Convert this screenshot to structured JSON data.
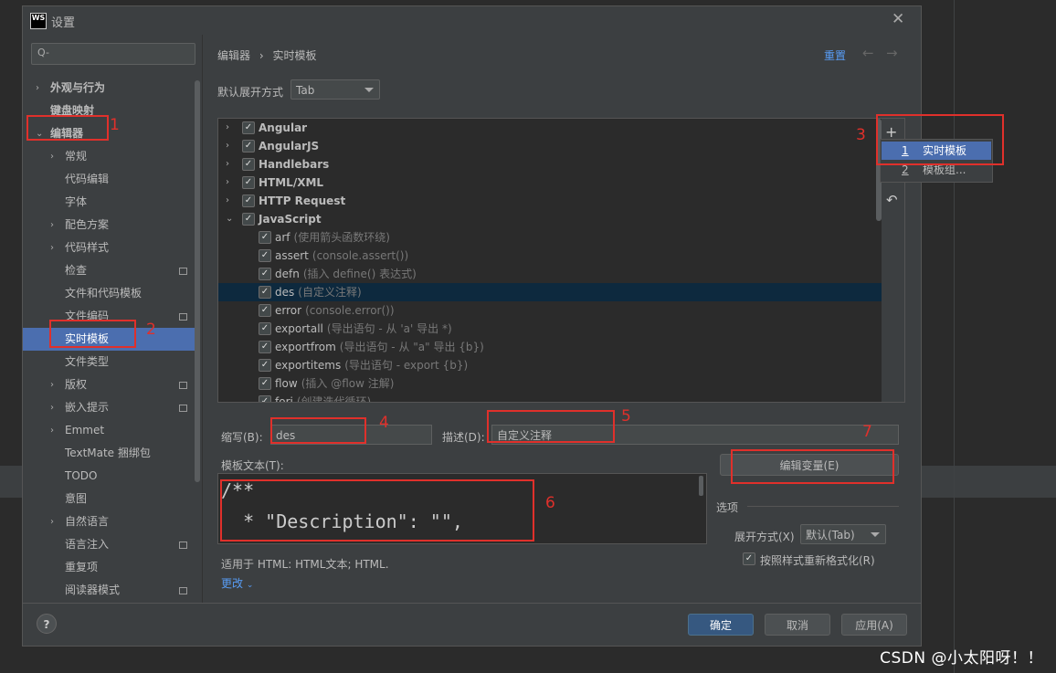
{
  "watermark": "CSDN @小太阳呀！！",
  "dialog": {
    "title": "设置",
    "app_icon_text": "WS",
    "close_glyph": "✕"
  },
  "sidebar": {
    "search_placeholder": "Q-",
    "items": [
      {
        "label": "外观与行为",
        "chevron": "›",
        "bold": true
      },
      {
        "label": "键盘映射",
        "chevron": "",
        "bold": true
      },
      {
        "label": "编辑器",
        "chevron": "⌄",
        "bold": true
      },
      {
        "label": "常规",
        "chevron": "›"
      },
      {
        "label": "代码编辑",
        "chevron": ""
      },
      {
        "label": "字体",
        "chevron": ""
      },
      {
        "label": "配色方案",
        "chevron": "›"
      },
      {
        "label": "代码样式",
        "chevron": "›"
      },
      {
        "label": "检查",
        "chevron": "",
        "mini": true
      },
      {
        "label": "文件和代码模板",
        "chevron": ""
      },
      {
        "label": "文件编码",
        "chevron": "",
        "mini": true
      },
      {
        "label": "实时模板",
        "chevron": "",
        "selected": true
      },
      {
        "label": "文件类型",
        "chevron": ""
      },
      {
        "label": "版权",
        "chevron": "›",
        "mini": true
      },
      {
        "label": "嵌入提示",
        "chevron": "›",
        "mini": true
      },
      {
        "label": "Emmet",
        "chevron": "›"
      },
      {
        "label": "TextMate 捆绑包",
        "chevron": ""
      },
      {
        "label": "TODO",
        "chevron": ""
      },
      {
        "label": "意图",
        "chevron": ""
      },
      {
        "label": "自然语言",
        "chevron": "›"
      },
      {
        "label": "语言注入",
        "chevron": "",
        "mini": true
      },
      {
        "label": "重复项",
        "chevron": ""
      },
      {
        "label": "阅读器模式",
        "chevron": "",
        "mini": true
      }
    ]
  },
  "header": {
    "breadcrumb_parent": "编辑器",
    "breadcrumb_sep": "›",
    "breadcrumb_current": "实时模板",
    "reset_label": "重置",
    "back_arrow": "←",
    "forward_arrow": "→"
  },
  "expand_with": {
    "label": "默认展开方式",
    "value": "Tab"
  },
  "template_list": [
    {
      "name": "Angular",
      "group": true,
      "expanded": false,
      "checked": true
    },
    {
      "name": "AngularJS",
      "group": true,
      "expanded": false,
      "checked": true
    },
    {
      "name": "Handlebars",
      "group": true,
      "expanded": false,
      "checked": true
    },
    {
      "name": "HTML/XML",
      "group": true,
      "expanded": false,
      "checked": true
    },
    {
      "name": "HTTP Request",
      "group": true,
      "expanded": false,
      "checked": true
    },
    {
      "name": "JavaScript",
      "group": true,
      "expanded": true,
      "checked": true
    },
    {
      "name": "arf",
      "desc": "(使用箭头函数环绕)",
      "checked": true
    },
    {
      "name": "assert",
      "desc": "(console.assert())",
      "checked": true
    },
    {
      "name": "defn",
      "desc": "(插入 define() 表达式)",
      "checked": true
    },
    {
      "name": "des",
      "desc": "(自定义注释)",
      "checked": true,
      "selected": true
    },
    {
      "name": "error",
      "desc": "(console.error())",
      "checked": true
    },
    {
      "name": "exportall",
      "desc": "(导出语句 - 从 'a' 导出 *)",
      "checked": true
    },
    {
      "name": "exportfrom",
      "desc": "(导出语句 - 从 \"a\" 导出 {b})",
      "checked": true
    },
    {
      "name": "exportitems",
      "desc": "(导出语句 - export {b})",
      "checked": true
    },
    {
      "name": "flow",
      "desc": "(插入 @flow 注解)",
      "checked": true
    },
    {
      "name": "fori",
      "desc": "(创建迭代循环)",
      "checked": true
    }
  ],
  "toolbar": {
    "add_glyph": "+",
    "undo_glyph": "↶"
  },
  "add_menu": [
    {
      "key": "1",
      "label": "实时模板",
      "selected": true
    },
    {
      "key": "2",
      "label": "模板组..."
    }
  ],
  "form": {
    "abbrev_label": "缩写(B):",
    "abbrev_value": "des",
    "desc_label": "描述(D):",
    "desc_value": "自定义注释",
    "template_text_label": "模板文本(T):",
    "code_line1": "/**",
    "code_line2": "  * \"Description\": \"\",",
    "edit_vars_label": "编辑变量(E)",
    "options_label": "选项",
    "expand_label": "展开方式(X)",
    "expand_value": "默认(Tab)",
    "reformat_label": "按照样式重新格式化(R)",
    "applicable_text": "适用于 HTML: HTML文本; HTML.",
    "change_link": "更改"
  },
  "footer": {
    "help": "?",
    "ok": "确定",
    "cancel": "取消",
    "apply": "应用(A)"
  },
  "annotations": [
    "1",
    "2",
    "3",
    "4",
    "5",
    "6",
    "7"
  ],
  "colors": {
    "accent": "#4b6eaf",
    "annotation": "#e0302b",
    "link": "#589df6"
  }
}
